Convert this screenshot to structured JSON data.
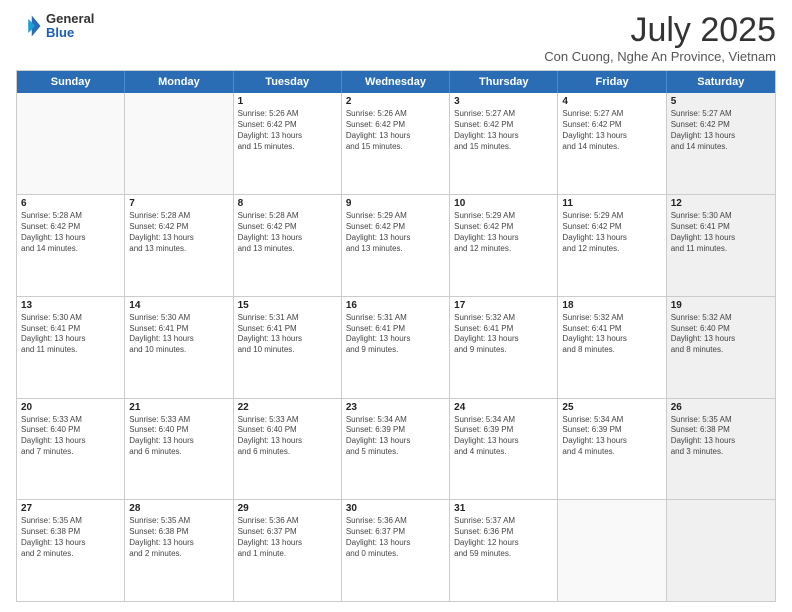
{
  "logo": {
    "general": "General",
    "blue": "Blue"
  },
  "title": "July 2025",
  "location": "Con Cuong, Nghe An Province, Vietnam",
  "headers": [
    "Sunday",
    "Monday",
    "Tuesday",
    "Wednesday",
    "Thursday",
    "Friday",
    "Saturday"
  ],
  "weeks": [
    [
      {
        "day": "",
        "info": "",
        "empty": true
      },
      {
        "day": "",
        "info": "",
        "empty": true
      },
      {
        "day": "1",
        "info": "Sunrise: 5:26 AM\nSunset: 6:42 PM\nDaylight: 13 hours\nand 15 minutes.",
        "empty": false
      },
      {
        "day": "2",
        "info": "Sunrise: 5:26 AM\nSunset: 6:42 PM\nDaylight: 13 hours\nand 15 minutes.",
        "empty": false
      },
      {
        "day": "3",
        "info": "Sunrise: 5:27 AM\nSunset: 6:42 PM\nDaylight: 13 hours\nand 15 minutes.",
        "empty": false
      },
      {
        "day": "4",
        "info": "Sunrise: 5:27 AM\nSunset: 6:42 PM\nDaylight: 13 hours\nand 14 minutes.",
        "empty": false
      },
      {
        "day": "5",
        "info": "Sunrise: 5:27 AM\nSunset: 6:42 PM\nDaylight: 13 hours\nand 14 minutes.",
        "empty": false,
        "shaded": true
      }
    ],
    [
      {
        "day": "6",
        "info": "Sunrise: 5:28 AM\nSunset: 6:42 PM\nDaylight: 13 hours\nand 14 minutes.",
        "empty": false
      },
      {
        "day": "7",
        "info": "Sunrise: 5:28 AM\nSunset: 6:42 PM\nDaylight: 13 hours\nand 13 minutes.",
        "empty": false
      },
      {
        "day": "8",
        "info": "Sunrise: 5:28 AM\nSunset: 6:42 PM\nDaylight: 13 hours\nand 13 minutes.",
        "empty": false
      },
      {
        "day": "9",
        "info": "Sunrise: 5:29 AM\nSunset: 6:42 PM\nDaylight: 13 hours\nand 13 minutes.",
        "empty": false
      },
      {
        "day": "10",
        "info": "Sunrise: 5:29 AM\nSunset: 6:42 PM\nDaylight: 13 hours\nand 12 minutes.",
        "empty": false
      },
      {
        "day": "11",
        "info": "Sunrise: 5:29 AM\nSunset: 6:42 PM\nDaylight: 13 hours\nand 12 minutes.",
        "empty": false
      },
      {
        "day": "12",
        "info": "Sunrise: 5:30 AM\nSunset: 6:41 PM\nDaylight: 13 hours\nand 11 minutes.",
        "empty": false,
        "shaded": true
      }
    ],
    [
      {
        "day": "13",
        "info": "Sunrise: 5:30 AM\nSunset: 6:41 PM\nDaylight: 13 hours\nand 11 minutes.",
        "empty": false
      },
      {
        "day": "14",
        "info": "Sunrise: 5:30 AM\nSunset: 6:41 PM\nDaylight: 13 hours\nand 10 minutes.",
        "empty": false
      },
      {
        "day": "15",
        "info": "Sunrise: 5:31 AM\nSunset: 6:41 PM\nDaylight: 13 hours\nand 10 minutes.",
        "empty": false
      },
      {
        "day": "16",
        "info": "Sunrise: 5:31 AM\nSunset: 6:41 PM\nDaylight: 13 hours\nand 9 minutes.",
        "empty": false
      },
      {
        "day": "17",
        "info": "Sunrise: 5:32 AM\nSunset: 6:41 PM\nDaylight: 13 hours\nand 9 minutes.",
        "empty": false
      },
      {
        "day": "18",
        "info": "Sunrise: 5:32 AM\nSunset: 6:41 PM\nDaylight: 13 hours\nand 8 minutes.",
        "empty": false
      },
      {
        "day": "19",
        "info": "Sunrise: 5:32 AM\nSunset: 6:40 PM\nDaylight: 13 hours\nand 8 minutes.",
        "empty": false,
        "shaded": true
      }
    ],
    [
      {
        "day": "20",
        "info": "Sunrise: 5:33 AM\nSunset: 6:40 PM\nDaylight: 13 hours\nand 7 minutes.",
        "empty": false
      },
      {
        "day": "21",
        "info": "Sunrise: 5:33 AM\nSunset: 6:40 PM\nDaylight: 13 hours\nand 6 minutes.",
        "empty": false
      },
      {
        "day": "22",
        "info": "Sunrise: 5:33 AM\nSunset: 6:40 PM\nDaylight: 13 hours\nand 6 minutes.",
        "empty": false
      },
      {
        "day": "23",
        "info": "Sunrise: 5:34 AM\nSunset: 6:39 PM\nDaylight: 13 hours\nand 5 minutes.",
        "empty": false
      },
      {
        "day": "24",
        "info": "Sunrise: 5:34 AM\nSunset: 6:39 PM\nDaylight: 13 hours\nand 4 minutes.",
        "empty": false
      },
      {
        "day": "25",
        "info": "Sunrise: 5:34 AM\nSunset: 6:39 PM\nDaylight: 13 hours\nand 4 minutes.",
        "empty": false
      },
      {
        "day": "26",
        "info": "Sunrise: 5:35 AM\nSunset: 6:38 PM\nDaylight: 13 hours\nand 3 minutes.",
        "empty": false,
        "shaded": true
      }
    ],
    [
      {
        "day": "27",
        "info": "Sunrise: 5:35 AM\nSunset: 6:38 PM\nDaylight: 13 hours\nand 2 minutes.",
        "empty": false
      },
      {
        "day": "28",
        "info": "Sunrise: 5:35 AM\nSunset: 6:38 PM\nDaylight: 13 hours\nand 2 minutes.",
        "empty": false
      },
      {
        "day": "29",
        "info": "Sunrise: 5:36 AM\nSunset: 6:37 PM\nDaylight: 13 hours\nand 1 minute.",
        "empty": false
      },
      {
        "day": "30",
        "info": "Sunrise: 5:36 AM\nSunset: 6:37 PM\nDaylight: 13 hours\nand 0 minutes.",
        "empty": false
      },
      {
        "day": "31",
        "info": "Sunrise: 5:37 AM\nSunset: 6:36 PM\nDaylight: 12 hours\nand 59 minutes.",
        "empty": false
      },
      {
        "day": "",
        "info": "",
        "empty": true
      },
      {
        "day": "",
        "info": "",
        "empty": true,
        "shaded": true
      }
    ]
  ]
}
